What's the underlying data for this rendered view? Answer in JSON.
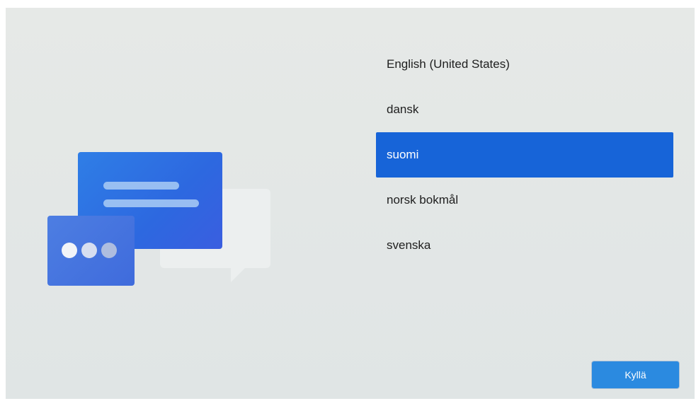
{
  "languages": {
    "items": [
      {
        "label": "English (United States)",
        "selected": false
      },
      {
        "label": "dansk",
        "selected": false
      },
      {
        "label": "suomi",
        "selected": true
      },
      {
        "label": "norsk bokmål",
        "selected": false
      },
      {
        "label": "svenska",
        "selected": false
      }
    ]
  },
  "actions": {
    "confirm_label": "Kyllä"
  },
  "colors": {
    "selection": "#1764d8",
    "button": "#2b8ae0",
    "illustration_blue": "#2d68e0"
  }
}
